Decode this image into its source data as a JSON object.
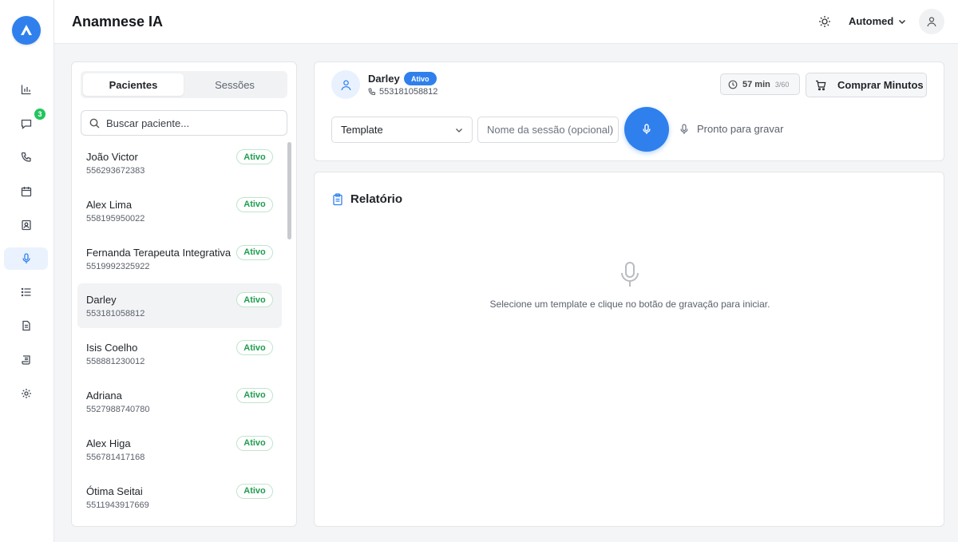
{
  "app": {
    "title": "Anamnese IA"
  },
  "topbar": {
    "org_name": "Automed"
  },
  "rail": {
    "items": [
      {
        "name": "reports",
        "icon": "bar-chart-icon"
      },
      {
        "name": "messages",
        "icon": "chat-bubble-icon",
        "badge": "3"
      },
      {
        "name": "calls",
        "icon": "phone-icon"
      },
      {
        "name": "calendar",
        "icon": "calendar-icon"
      },
      {
        "name": "contacts",
        "icon": "contact-card-icon"
      },
      {
        "name": "anamnese",
        "icon": "microphone-icon",
        "active": true
      },
      {
        "name": "lists",
        "icon": "list-icon"
      },
      {
        "name": "documents",
        "icon": "document-icon"
      },
      {
        "name": "scripts",
        "icon": "scroll-icon"
      },
      {
        "name": "settings",
        "icon": "gear-icon"
      }
    ]
  },
  "patients_panel": {
    "tabs": [
      {
        "label": "Pacientes",
        "active": true
      },
      {
        "label": "Sessões",
        "active": false
      }
    ],
    "search_placeholder": "Buscar paciente...",
    "patients": [
      {
        "name": "João Victor",
        "phone": "556293672383",
        "status": "Ativo"
      },
      {
        "name": "Alex Lima",
        "phone": "558195950022",
        "status": "Ativo"
      },
      {
        "name": "Fernanda Terapeuta Integrativa",
        "phone": "5519992325922",
        "status": "Ativo"
      },
      {
        "name": "Darley",
        "phone": "553181058812",
        "status": "Ativo",
        "selected": true
      },
      {
        "name": "Isis Coelho",
        "phone": "558881230012",
        "status": "Ativo"
      },
      {
        "name": "Adriana",
        "phone": "5527988740780",
        "status": "Ativo"
      },
      {
        "name": "Alex Higa",
        "phone": "556781417168",
        "status": "Ativo"
      },
      {
        "name": "Ótima Seitai",
        "phone": "5511943917669",
        "status": "Ativo"
      }
    ]
  },
  "session": {
    "patient_name": "Darley",
    "patient_status": "Ativo",
    "patient_phone": "553181058812",
    "minutes_label": "57 min",
    "minutes_ratio": "3/60",
    "buy_label": "Comprar Minutos",
    "template_label": "Template",
    "session_name_placeholder": "Nome da sessão (opcional)",
    "record_status": "Pronto para gravar"
  },
  "report": {
    "title": "Relatório",
    "empty_message": "Selecione um template e clique no botão de gravação para iniciar."
  },
  "colors": {
    "accent": "#2f80ed",
    "success": "#1f9d4f",
    "badge_green": "#22c55e"
  }
}
